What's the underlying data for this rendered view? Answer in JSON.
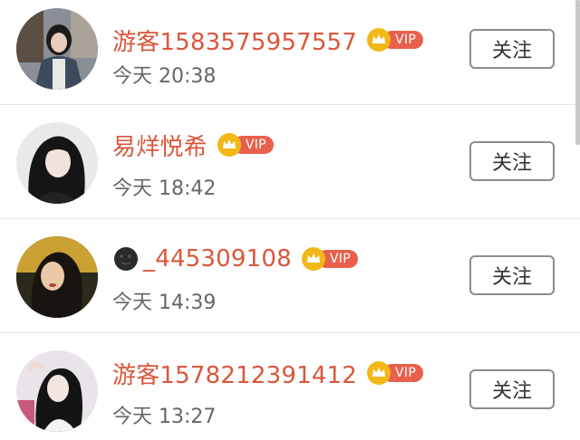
{
  "users": [
    {
      "name": "游客1583575957557",
      "emoji": "",
      "vip": "VIP",
      "time": "今天 20:38",
      "follow_label": "关注"
    },
    {
      "name": "易烊悦希",
      "emoji": "",
      "vip": "VIP",
      "time": "今天 18:42",
      "follow_label": "关注"
    },
    {
      "name": "_445309108",
      "emoji": "new-moon-face-icon",
      "vip": "VIP",
      "time": "今天 14:39",
      "follow_label": "关注"
    },
    {
      "name": "游客1578212391412",
      "emoji": "",
      "vip": "VIP",
      "time": "今天 13:27",
      "follow_label": "关注"
    }
  ],
  "colors": {
    "username": "#d9573b",
    "vip_pill": "#e8604c",
    "vip_crown": "#f2b818",
    "time": "#666666",
    "button_border": "#8c8c8c"
  }
}
